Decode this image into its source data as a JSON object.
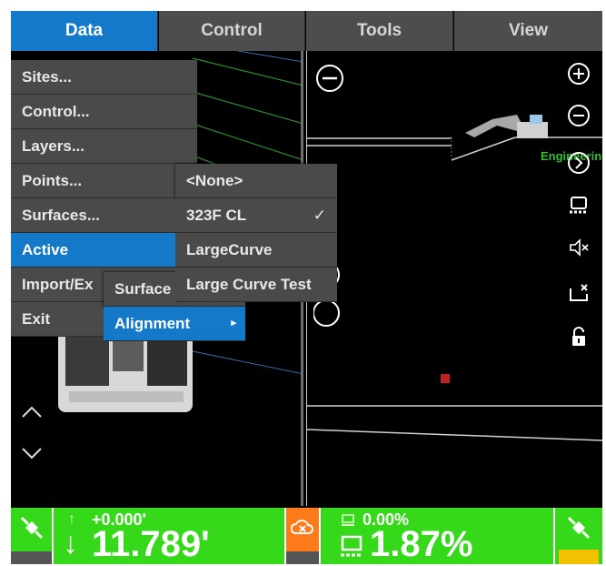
{
  "tabs": [
    "Data",
    "Control",
    "Tools",
    "View"
  ],
  "data_menu": [
    "Sites...",
    "Control...",
    "Layers...",
    "Points...",
    "Surfaces...",
    "Active",
    "Import/Ex",
    "Exit"
  ],
  "active_submenu": [
    "Surface",
    "Alignment"
  ],
  "alignment_menu": [
    {
      "label": "<None>",
      "check": ""
    },
    {
      "label": "323F CL",
      "check": "✓"
    },
    {
      "label": "LargeCurve",
      "check": ""
    },
    {
      "label": "Large Curve Test",
      "check": ""
    }
  ],
  "submenu_arrow": "▸",
  "engineering_label": "Engineering",
  "status": {
    "cross_slope_small": "+0.000'",
    "elevation": "11.789'",
    "grade_small": "0.00%",
    "grade_large": "1.87%"
  },
  "colors": {
    "accent": "#1479c9",
    "status_green": "#35d91a",
    "warning_orange": "#ff7a1a"
  },
  "icons": [
    "zoom-out-icon",
    "zoom-in-icon",
    "chevron-right-circle-icon",
    "machine-icon",
    "mute-icon",
    "bucket-icon",
    "lock-icon",
    "gps-icon",
    "warning-cloud-icon"
  ]
}
